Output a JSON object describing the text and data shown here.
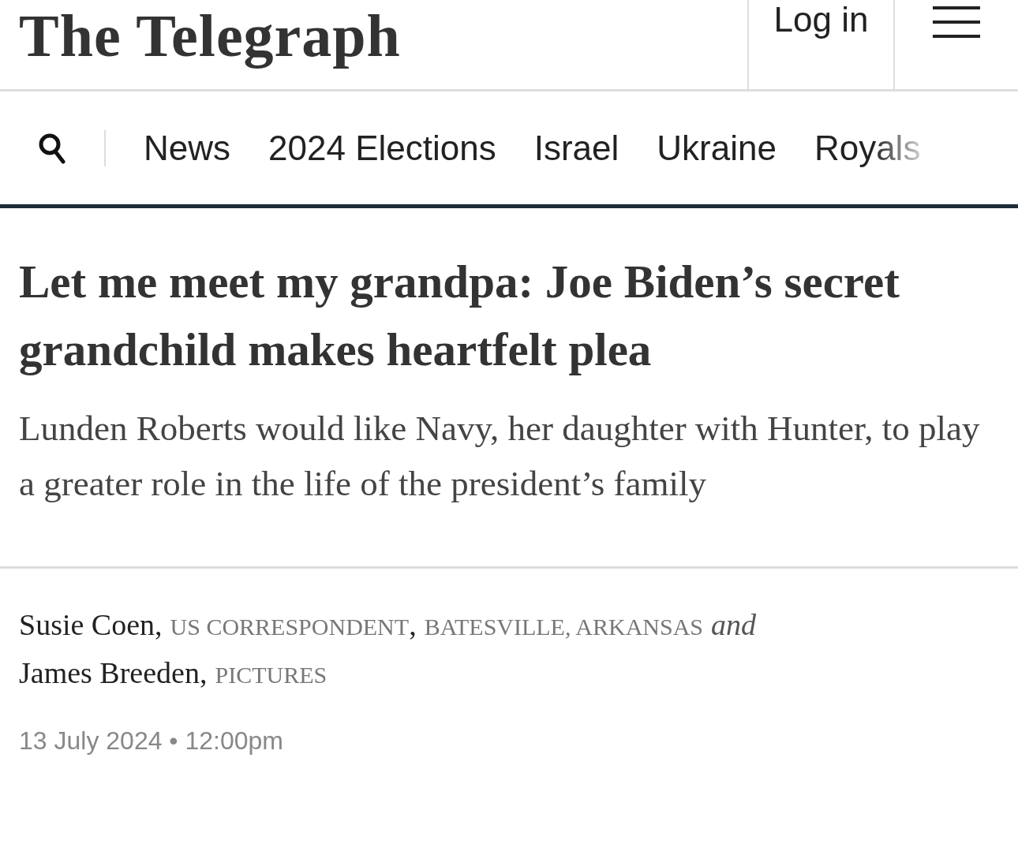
{
  "header": {
    "logo": "The Telegraph",
    "login": "Log in"
  },
  "nav": {
    "items": [
      "News",
      "2024 Elections",
      "Israel",
      "Ukraine",
      "Royals"
    ]
  },
  "article": {
    "headline": "Let me meet my grandpa: Joe Biden’s secret grandchild makes heartfelt plea",
    "standfirst": "Lunden Roberts would like Navy, her daughter with Hunter, to play a greater role in the life of the president’s family",
    "byline": [
      {
        "kind": "name",
        "text": "Susie Coen,"
      },
      {
        "kind": "role",
        "text": "US CORRESPONDENT"
      },
      {
        "kind": "plain",
        "text": ","
      },
      {
        "kind": "role",
        "text": "BATESVILLE, ARKANSAS"
      },
      {
        "kind": "italic",
        "text": "and"
      },
      {
        "kind": "break"
      },
      {
        "kind": "name",
        "text": "James Breeden,"
      },
      {
        "kind": "role",
        "text": "PICTURES"
      }
    ],
    "date": "13 July 2024 • 12:00pm"
  }
}
